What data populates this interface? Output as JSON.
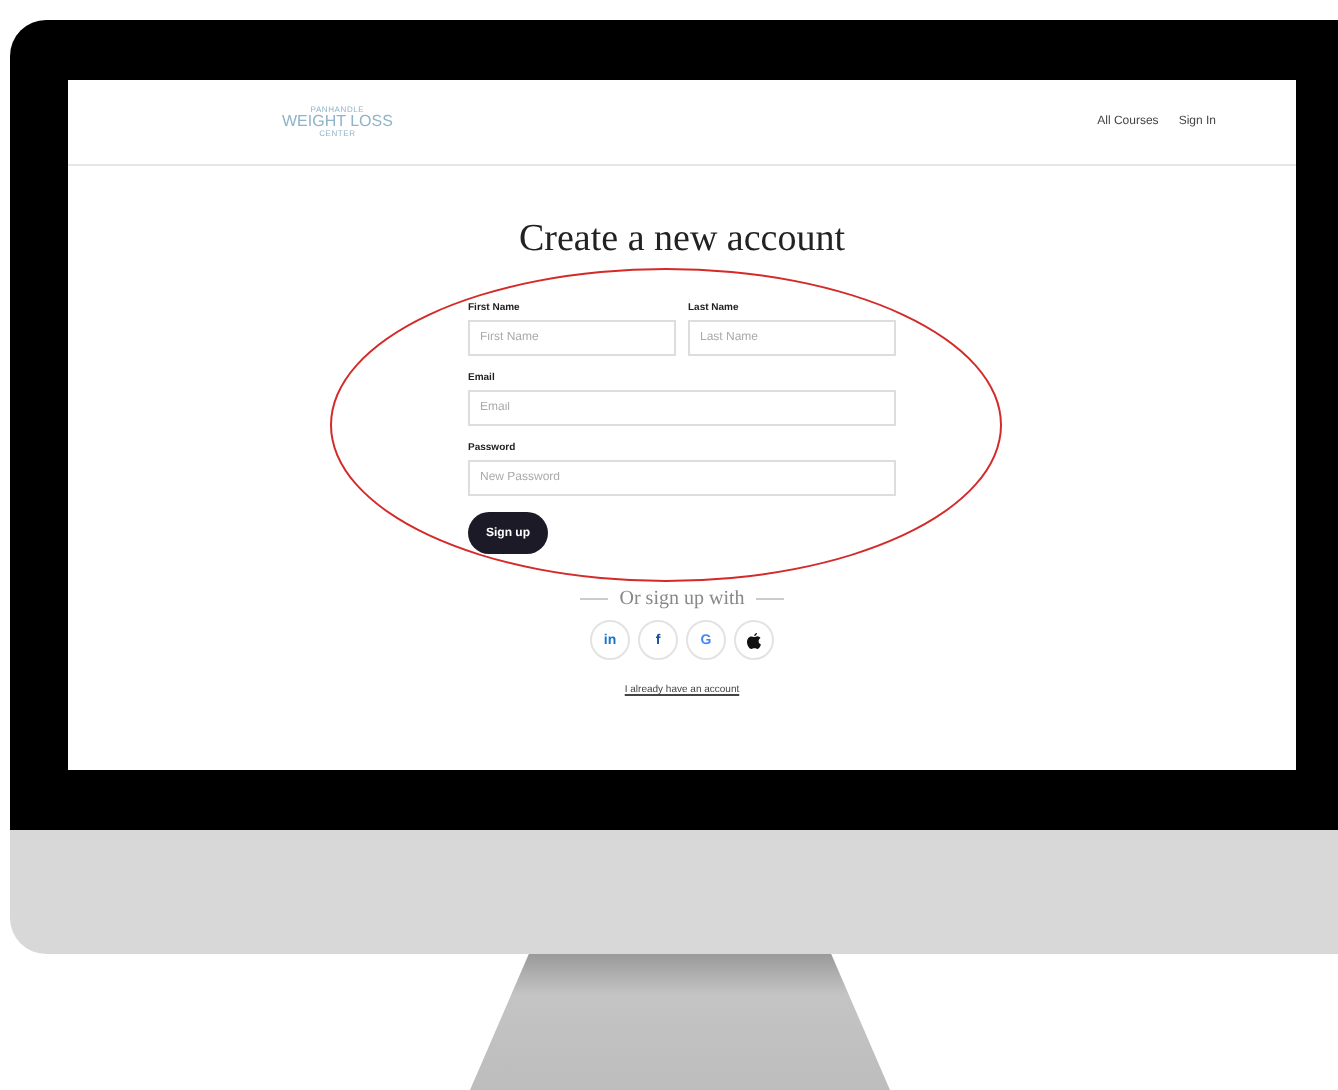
{
  "logo": {
    "lines": [
      "PANHANDLE",
      "WEIGHT LOSS",
      "CENTER"
    ]
  },
  "nav": [
    {
      "label": "All Courses"
    },
    {
      "label": "Sign In"
    }
  ],
  "title": "Create a new account",
  "form": {
    "name_row": [
      {
        "label": "First Name",
        "placeholder": "First Name"
      },
      {
        "label": "Last Name",
        "placeholder": "Last Name"
      }
    ],
    "fields": [
      {
        "label": "Email",
        "placeholder": "Email"
      },
      {
        "label": "Password",
        "placeholder": "New Password"
      }
    ],
    "submit": "Sign up"
  },
  "social": {
    "heading": "Or sign up with",
    "buttons": [
      {
        "kind": "text",
        "label": "in",
        "color": "#1a73c8"
      },
      {
        "kind": "text",
        "label": "f",
        "color": "#1a4fa0"
      },
      {
        "kind": "text",
        "label": "G",
        "color": "#4285f4"
      },
      {
        "kind": "icon",
        "color": "#111111"
      }
    ]
  },
  "signin_link": "I already have an account"
}
